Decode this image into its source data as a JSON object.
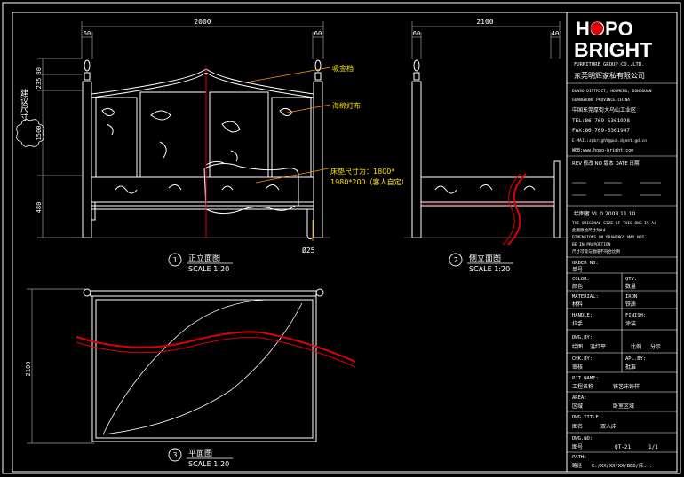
{
  "front_view": {
    "dim_total": "2000",
    "dim_left": "60",
    "dim_right": "60",
    "dim_top_a": "80",
    "dim_top_b": "235",
    "dim_mid": "1500",
    "dim_low": "480",
    "side_label": "建议尺寸",
    "label_finial": "吸金档",
    "label_fabric": "海绵灯布",
    "bed_size_line1": "床垫尺寸为：1800*",
    "bed_size_line2": "1980*200（客人自定）",
    "diameter": "Ø25",
    "view_num": "1",
    "view_title": "正立面图",
    "scale": "SCALE 1:20"
  },
  "side_view": {
    "dim_total": "2100",
    "dim_left": "60",
    "dim_right": "40",
    "view_num": "2",
    "view_title": "侧立面图",
    "scale": "SCALE 1:20"
  },
  "plan_view": {
    "dim_height": "2100",
    "view_num": "3",
    "view_title": "平面图",
    "scale": "SCALE 1:20"
  },
  "title_block": {
    "logo_line1": "HOPO",
    "logo_line2": "BRIGHT",
    "company_en": "FURNITURE GROUP CO.,LTD.",
    "company_cn": "东莞明辉家私有限公司",
    "addr1": "DUNSO DISTRICT, HOUMENG, DONGGUAN",
    "addr2": "GUANGDONG PROVINCE,CHINA",
    "addr3": "中国东莞厚街大乌山工业区",
    "tel": "TEL:86-769-5361998",
    "fax": "FAX:86-769-5361947",
    "email": "E-MAIL:zgbright@pub.dgnet.gd.cn",
    "web": "WEB:www.hopo-bright.com",
    "rev_header": "REV 修改   NO 版本   DATE 日期",
    "designer_line": "绘图者    VL.0  2008.11.10",
    "note1": "THE ORIGINAL SIZE OF THIS DWG IS A4",
    "note2": "此图原始尺寸为A4",
    "note3": "DIMENSIONS ON DRAWINGS MAY NOT",
    "note4": "BE IN PROPORTION",
    "note5": "尺寸可能与图纸不符合比例",
    "order_no_label": "ORDER NO:",
    "order_no_cn": "单号",
    "color_label": "COLOR:",
    "color_cn": "颜色",
    "qty_label": "QTY:",
    "qty_cn": "数量",
    "material_label": "MATERIAL:",
    "material_cn": "材料",
    "material_val": "IRON",
    "material_val_cn": "铁质",
    "handle_label": "HANDLE:",
    "handle_cn": "拉手",
    "finish_label": "FINISH:",
    "finish_cn": "涂装",
    "dwg_by_label": "DWG.BY:",
    "dwg_by_cn": "绘图",
    "dwg_by_name": "温红平",
    "scale_cn": "比例",
    "scale_val": "分示",
    "chk_label": "CHK.BY:",
    "chk_cn": "审核",
    "apl_label": "APL.BY:",
    "apl_cn": "批准",
    "prj_label": "PJT.NAME:",
    "prj_cn": "工程名称",
    "prj_val": "铁艺床饰样",
    "area_label": "AREA:",
    "area_cn": "区域",
    "area_val": "卧室区域",
    "dwg_title_label": "DWG.TITLE:",
    "dwg_title_cn": "图名",
    "dwg_title_val": "双人床",
    "dwg_no_label": "DWG.NO:",
    "dwg_no_cn": "图号",
    "dwg_no_val": "QT-21",
    "sheet": "1/1",
    "path_label": "PATH:",
    "path_cn": "路径",
    "path_val": "E:/XX/XX/XX/BED/床..."
  },
  "colors": {
    "line_white": "#ffffff",
    "dim_gray": "#9a9a9a",
    "accent_red": "#e00000",
    "text_yellow": "#ffe100",
    "leader_orange": "#ff9900"
  }
}
